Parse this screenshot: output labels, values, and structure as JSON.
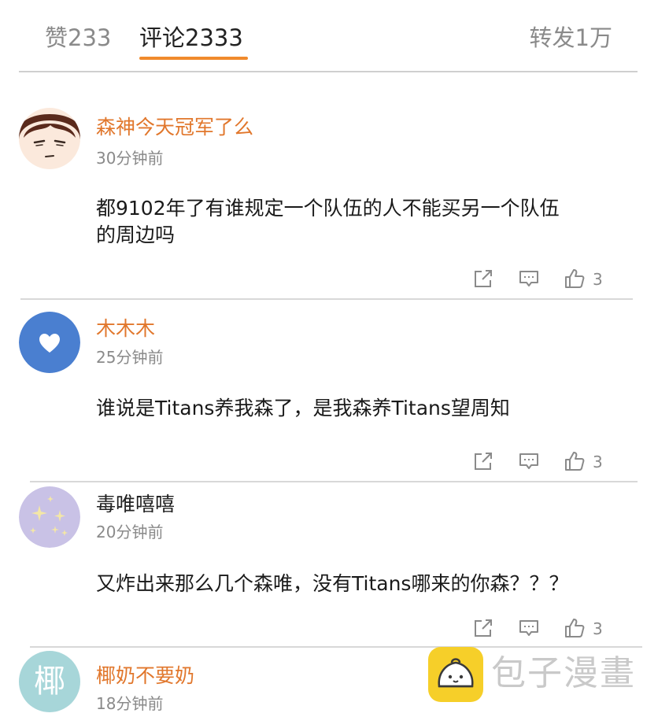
{
  "tabs": {
    "likes": "赞233",
    "comments": "评论2333",
    "reposts": "转发1万"
  },
  "comments": [
    {
      "username": "森神今天冠军了么",
      "time": "30分钟前",
      "text_line1": "都9102年了有谁规定一个队伍的人不能买另一个队伍",
      "text_line2": "的周边吗",
      "likes": "3",
      "avatar_icon": "cartoon-face-avatar"
    },
    {
      "username": "木木木",
      "time": "25分钟前",
      "text_line1": "谁说是Titans养我森了，是我森养Titans望周知",
      "likes": "3",
      "avatar_icon": "heart-avatar"
    },
    {
      "username": "毒唯嘻嘻",
      "time": "20分钟前",
      "text_line1": "又炸出来那么几个森唯，没有Titans哪来的你森？？？",
      "likes": "3",
      "avatar_icon": "sparkles-avatar"
    },
    {
      "username": "椰奶不要奶",
      "time": "18分钟前",
      "avatar_text": "椰",
      "avatar_icon": "calligraphy-avatar"
    }
  ],
  "watermark": {
    "text": "包子漫畫",
    "icon": "bun-logo-icon"
  },
  "colors": {
    "accent": "#f08a2c",
    "username_orange": "#e1772c",
    "muted": "#8a8a8a",
    "divider": "#d8d8d8",
    "watermark_yellow": "#f6cf29"
  }
}
